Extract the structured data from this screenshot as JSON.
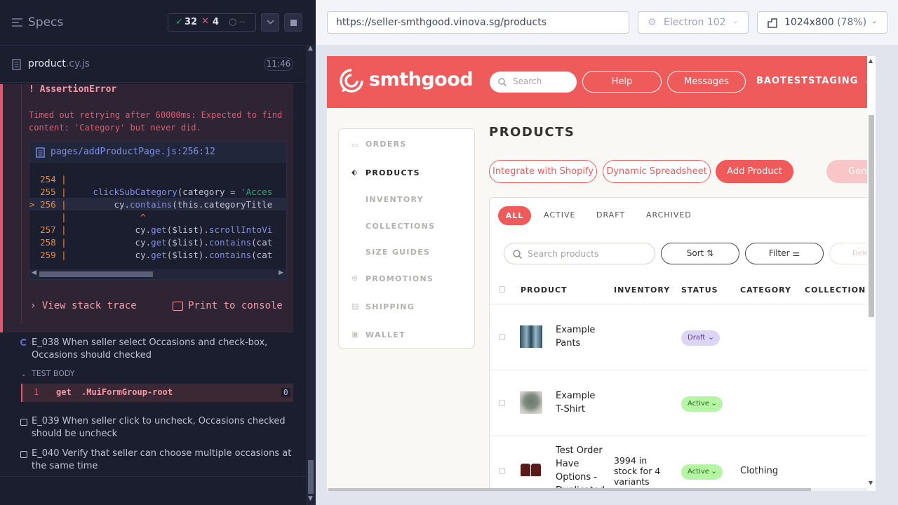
{
  "runner": {
    "specs_label": "Specs",
    "passed": "32",
    "failed": "4",
    "pending": "--",
    "spec_file": {
      "name": "product",
      "ext": ".cy.js",
      "duration": "11:46"
    },
    "error": {
      "title": "AssertionError",
      "message_1": "Timed out retrying after 60000ms: Expected to find",
      "message_2": "content: 'Category' but never did.",
      "file_link": "pages/addProductPage.js:256:12",
      "code": [
        {
          "num": "254",
          "marker": "",
          "text": ""
        },
        {
          "num": "255",
          "marker": "",
          "fn": "clickSubCategory",
          "rest": "(category = ",
          "str": "'Acces"
        },
        {
          "num": "256",
          "marker": ">",
          "pre": "    cy.",
          "fn": "contains",
          "rest": "(this.categoryTitle"
        },
        {
          "num": "",
          "marker": "",
          "caret": "^"
        },
        {
          "num": "257",
          "marker": "",
          "pre": "        cy.",
          "fn": "get",
          "rest": "($list).",
          "fn2": "scrollIntoVi"
        },
        {
          "num": "258",
          "marker": "",
          "pre": "        cy.",
          "fn": "get",
          "rest": "($list).",
          "fn2": "contains",
          "rest2": "(cat"
        },
        {
          "num": "259",
          "marker": "",
          "pre": "        cy.",
          "fn": "get",
          "rest": "($list).",
          "fn2": "contains",
          "rest2": "(cat"
        }
      ],
      "view_stack": "View stack trace",
      "print_console": "Print to console"
    },
    "tests": [
      {
        "id": "e038",
        "text_1": "E_038 When seller select Occasions and check-box,",
        "text_2": "Occasions should checked"
      },
      {
        "id": "e039",
        "text_1": "E_039 When seller click to uncheck, Occasions checked",
        "text_2": "should be uncheck"
      },
      {
        "id": "e040",
        "text_1": "E_040 Verify that seller can choose multiple occasions at",
        "text_2": "the same time"
      }
    ],
    "test_body_label": "TEST BODY",
    "command": {
      "index": "1",
      "name": "get",
      "selector": ".MuiFormGroup-root",
      "count": "0"
    }
  },
  "browser_bar": {
    "url": "https://seller-smthgood.vinova.sg/products",
    "browser": "Electron 102",
    "viewport": "1024x800",
    "zoom": "(78%)"
  },
  "app": {
    "brand": "smthgood",
    "search_placeholder": "Search",
    "help": "Help",
    "messages": "Messages",
    "account": "BAOTESTSTAGING",
    "page_title": "PRODUCTS",
    "nav": [
      "ORDERS",
      "PRODUCTS",
      "INVENTORY",
      "COLLECTIONS",
      "SIZE GUIDES",
      "PROMOTIONS",
      "SHIPPING",
      "WALLET"
    ],
    "actions": [
      "Integrate with Shopify",
      "Dynamic Spreadsheet",
      "Add Product",
      "Gene"
    ],
    "tabs": [
      "ALL",
      "ACTIVE",
      "DRAFT",
      "ARCHIVED"
    ],
    "search_products": "Search products",
    "sort": "Sort",
    "filter": "Filter",
    "delete": "Delete p",
    "columns": [
      "PRODUCT",
      "INVENTORY",
      "STATUS",
      "CATEGORY",
      "COLLECTION"
    ],
    "rows": [
      {
        "name_1": "Example",
        "name_2": "Pants",
        "name_3": "",
        "name_4": "",
        "inventory_1": "",
        "inventory_2": "",
        "inventory_3": "",
        "status": "Draft",
        "category": ""
      },
      {
        "name_1": "Example",
        "name_2": "T-Shirt",
        "name_3": "",
        "name_4": "",
        "inventory_1": "",
        "inventory_2": "",
        "inventory_3": "",
        "status": "Active",
        "category": ""
      },
      {
        "name_1": "Test Order",
        "name_2": "Have",
        "name_3": "Options -",
        "name_4": "Duplicated",
        "inventory_1": "3994 in",
        "inventory_2": "stock for 4",
        "inventory_3": "variants",
        "status": "Active",
        "category": "Clothing"
      }
    ],
    "colors": {
      "brand": "#ef5a5a",
      "draft_bg": "#ddd5f5",
      "active_bg": "#b5f5a5"
    }
  }
}
